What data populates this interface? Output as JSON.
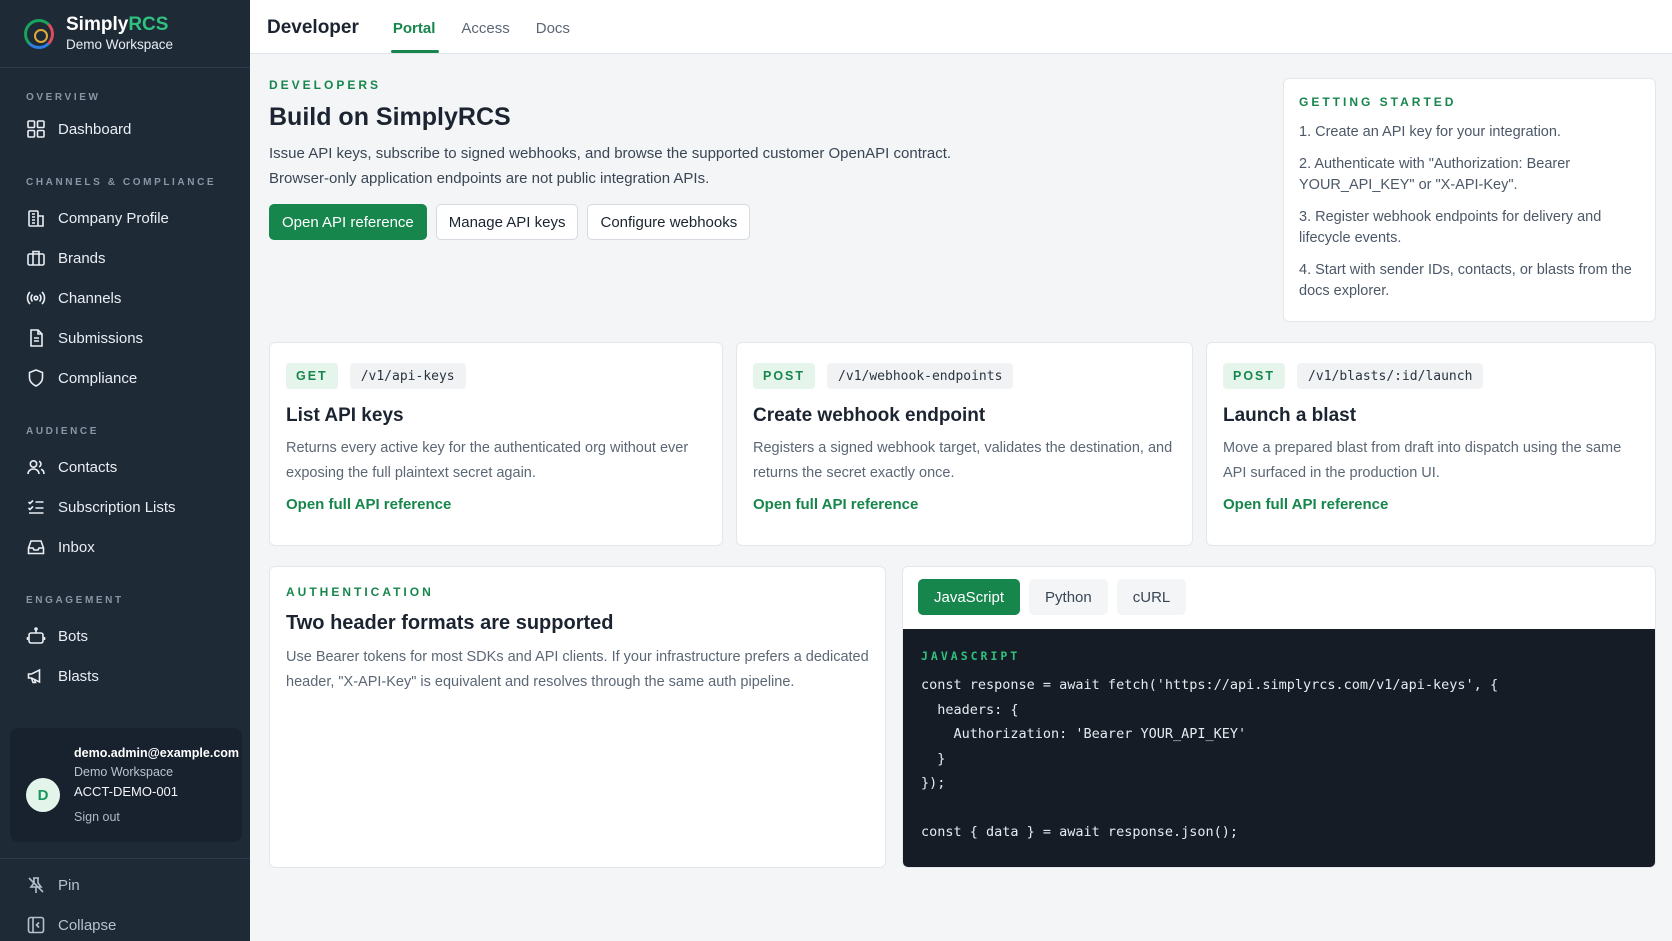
{
  "brand": {
    "name_part1": "Simply",
    "name_part2": "RCS",
    "workspace": "Demo Workspace"
  },
  "sidebar": {
    "sections": [
      {
        "title": "OVERVIEW",
        "items": [
          {
            "label": "Dashboard",
            "icon": "grid-icon"
          }
        ]
      },
      {
        "title": "CHANNELS & COMPLIANCE",
        "items": [
          {
            "label": "Company Profile",
            "icon": "building-icon"
          },
          {
            "label": "Brands",
            "icon": "briefcase-icon"
          },
          {
            "label": "Channels",
            "icon": "broadcast-icon"
          },
          {
            "label": "Submissions",
            "icon": "document-icon"
          },
          {
            "label": "Compliance",
            "icon": "shield-icon"
          }
        ]
      },
      {
        "title": "AUDIENCE",
        "items": [
          {
            "label": "Contacts",
            "icon": "users-icon"
          },
          {
            "label": "Subscription Lists",
            "icon": "checklist-icon"
          },
          {
            "label": "Inbox",
            "icon": "inbox-icon"
          }
        ]
      },
      {
        "title": "ENGAGEMENT",
        "items": [
          {
            "label": "Bots",
            "icon": "bot-icon"
          },
          {
            "label": "Blasts",
            "icon": "megaphone-icon"
          }
        ]
      }
    ],
    "user": {
      "initial": "D",
      "email": "demo.admin@example.com",
      "workspace": "Demo Workspace",
      "account": "ACCT-DEMO-001",
      "sign_out": "Sign out"
    },
    "bottom": {
      "pin": "Pin",
      "collapse": "Collapse"
    }
  },
  "topbar": {
    "title": "Developer",
    "tabs": [
      {
        "label": "Portal",
        "active": true
      },
      {
        "label": "Access"
      },
      {
        "label": "Docs"
      }
    ]
  },
  "hero": {
    "eyebrow": "DEVELOPERS",
    "title": "Build on SimplyRCS",
    "desc_line1": "Issue API keys, subscribe to signed webhooks, and browse the supported customer OpenAPI contract.",
    "desc_line2": "Browser-only application endpoints are not public integration APIs.",
    "buttons": {
      "primary": "Open API reference",
      "keys": "Manage API keys",
      "webhooks": "Configure webhooks"
    }
  },
  "getting_started": {
    "title": "GETTING STARTED",
    "steps": [
      "1. Create an API key for your integration.",
      "2. Authenticate with \"Authorization: Bearer YOUR_API_KEY\" or \"X-API-Key\".",
      "3. Register webhook endpoints for delivery and lifecycle events.",
      "4. Start with sender IDs, contacts, or blasts from the docs explorer."
    ]
  },
  "endpoints": [
    {
      "method": "GET",
      "path": "/v1/api-keys",
      "title": "List API keys",
      "desc": "Returns every active key for the authenticated org without ever exposing the full plaintext secret again.",
      "link": "Open full API reference"
    },
    {
      "method": "POST",
      "path": "/v1/webhook-endpoints",
      "title": "Create webhook endpoint",
      "desc": "Registers a signed webhook target, validates the destination, and returns the secret exactly once.",
      "link": "Open full API reference"
    },
    {
      "method": "POST",
      "path": "/v1/blasts/:id/launch",
      "title": "Launch a blast",
      "desc": "Move a prepared blast from draft into dispatch using the same API surfaced in the production UI.",
      "link": "Open full API reference"
    }
  ],
  "auth": {
    "eyebrow": "AUTHENTICATION",
    "title": "Two header formats are supported",
    "desc": "Use Bearer tokens for most SDKs and API clients. If your infrastructure prefers a dedicated header, \"X-API-Key\" is equivalent and resolves through the same auth pipeline."
  },
  "code": {
    "tabs": [
      {
        "label": "JavaScript",
        "active": true
      },
      {
        "label": "Python"
      },
      {
        "label": "cURL"
      }
    ],
    "label": "JAVASCRIPT",
    "snippet": "const response = await fetch('https://api.simplyrcs.com/v1/api-keys', {\n  headers: {\n    Authorization: 'Bearer YOUR_API_KEY'\n  }\n});\n\nconst { data } = await response.json();"
  },
  "colors": {
    "accent": "#17864c",
    "sidebar_bg": "#1f2a37",
    "code_bg": "#151c26"
  }
}
